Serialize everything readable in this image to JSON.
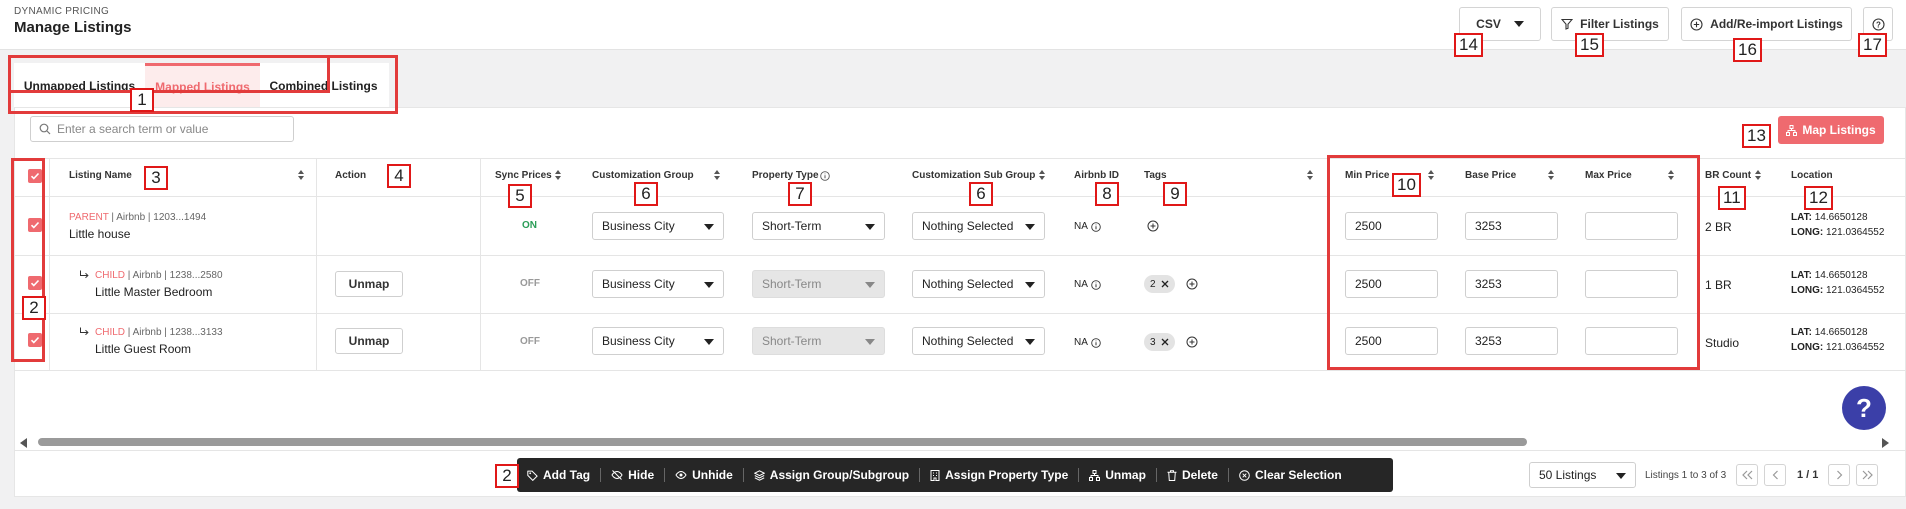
{
  "header": {
    "eyebrow": "DYNAMIC PRICING",
    "title": "Manage Listings",
    "csv_label": "CSV",
    "filter_label": "Filter Listings",
    "add_label": "Add/Re-import Listings"
  },
  "tabs": [
    {
      "label": "Unmapped Listings"
    },
    {
      "label": "Mapped Listings",
      "active": true
    },
    {
      "label": "Combined Listings"
    }
  ],
  "search": {
    "placeholder": "Enter a search term or value"
  },
  "map_listings_label": "Map Listings",
  "columns": {
    "listing_name": "Listing Name",
    "action": "Action",
    "sync_prices": "Sync Prices",
    "customization_group": "Customization Group",
    "property_type": "Property Type",
    "customization_sub_group": "Customization Sub Group",
    "airbnb_id": "Airbnb ID",
    "tags": "Tags",
    "min_price": "Min Price",
    "base_price": "Base Price",
    "max_price": "Max Price",
    "br_count": "BR Count",
    "location": "Location"
  },
  "rows": [
    {
      "role": "PARENT",
      "source": "| Airbnb | 1203...1494",
      "name": "Little house",
      "action": "",
      "sync": "ON",
      "group": "Business City",
      "type": "Short-Term",
      "subgroup": "Nothing Selected",
      "airbnb_id": "NA",
      "tags": "",
      "min": "2500",
      "base": "3253",
      "max": "",
      "br": "2 BR",
      "lat_label": "LAT:",
      "lat": "14.6650128",
      "long_label": "LONG:",
      "long": "121.0364552"
    },
    {
      "role": "CHILD",
      "source": "| Airbnb | 1238...2580",
      "name": "Little Master Bedroom",
      "action": "Unmap",
      "sync": "OFF",
      "group": "Business City",
      "type": "Short-Term",
      "subgroup": "Nothing Selected",
      "airbnb_id": "NA",
      "tags": "2",
      "min": "2500",
      "base": "3253",
      "max": "",
      "br": "1 BR",
      "lat_label": "LAT:",
      "lat": "14.6650128",
      "long_label": "LONG:",
      "long": "121.0364552"
    },
    {
      "role": "CHILD",
      "source": "| Airbnb | 1238...3133",
      "name": "Little Guest Room",
      "action": "Unmap",
      "sync": "OFF",
      "group": "Business City",
      "type": "Short-Term",
      "subgroup": "Nothing Selected",
      "airbnb_id": "NA",
      "tags": "3",
      "min": "2500",
      "base": "3253",
      "max": "",
      "br": "Studio",
      "lat_label": "LAT:",
      "lat": "14.6650128",
      "long_label": "LONG:",
      "long": "121.0364552"
    }
  ],
  "bulk": {
    "add_tag": "Add Tag",
    "hide": "Hide",
    "unhide": "Unhide",
    "assign_group": "Assign Group/Subgroup",
    "assign_type": "Assign Property Type",
    "unmap": "Unmap",
    "delete": "Delete",
    "clear": "Clear Selection"
  },
  "pagination": {
    "page_size": "50 Listings",
    "range": "Listings 1 to 3 of 3",
    "page": "1 / 1"
  },
  "annotations": [
    "1",
    "2",
    "3",
    "4",
    "5",
    "6",
    "7",
    "6",
    "8",
    "9",
    "10",
    "11",
    "12",
    "13",
    "14",
    "15",
    "16",
    "17",
    "2"
  ],
  "colors": {
    "accent": "#ef6a6f",
    "annotation_red": "#e23b3b",
    "sync_on": "#2a9d57",
    "help_fab": "#3b3fa8"
  }
}
